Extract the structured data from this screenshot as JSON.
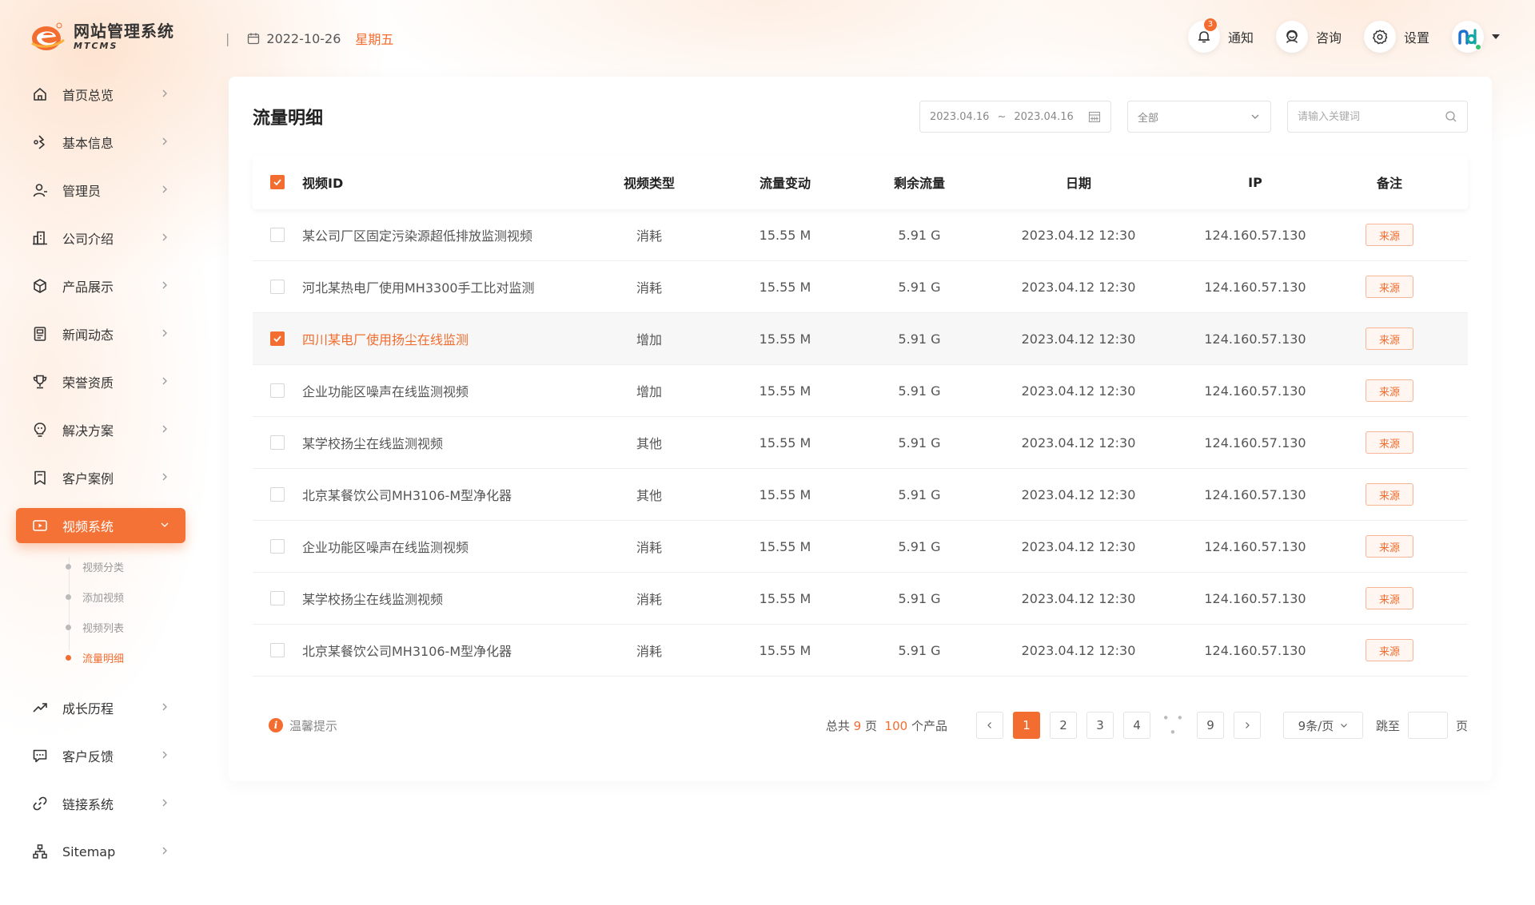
{
  "app": {
    "title": "网站管理系统",
    "subtitle": "MTCMS"
  },
  "header": {
    "date": "2022-10-26",
    "weekday": "星期五",
    "notify": {
      "label": "通知",
      "count": "3"
    },
    "consult": {
      "label": "咨询"
    },
    "settings": {
      "label": "设置"
    }
  },
  "sidebar": {
    "items": [
      {
        "label": "首页总览",
        "icon": "home-icon"
      },
      {
        "label": "基本信息",
        "icon": "info-icon"
      },
      {
        "label": "管理员",
        "icon": "user-icon"
      },
      {
        "label": "公司介绍",
        "icon": "building-icon"
      },
      {
        "label": "产品展示",
        "icon": "cube-icon"
      },
      {
        "label": "新闻动态",
        "icon": "news-icon"
      },
      {
        "label": "荣誉资质",
        "icon": "trophy-icon"
      },
      {
        "label": "解决方案",
        "icon": "bulb-icon"
      },
      {
        "label": "客户案例",
        "icon": "bookmark-icon"
      },
      {
        "label": "视频系统",
        "icon": "video-icon",
        "active": true
      },
      {
        "label": "成长历程",
        "icon": "trend-icon"
      },
      {
        "label": "客户反馈",
        "icon": "chat-icon"
      },
      {
        "label": "链接系统",
        "icon": "link-icon"
      },
      {
        "label": "Sitemap",
        "icon": "sitemap-icon"
      }
    ],
    "video_sub": [
      {
        "label": "视频分类"
      },
      {
        "label": "添加视频"
      },
      {
        "label": "视频列表"
      },
      {
        "label": "流量明细",
        "active": true
      }
    ]
  },
  "main": {
    "title": "流量明细",
    "filters": {
      "date_start": "2023.04.16",
      "date_sep": "~",
      "date_end": "2023.04.16",
      "type_select": "全部",
      "search_placeholder": "请输入关键词"
    },
    "columns": [
      "视频ID",
      "视频类型",
      "流量变动",
      "剩余流量",
      "日期",
      "IP",
      "备注"
    ],
    "rows": [
      {
        "name": "某公司厂区固定污染源超低排放监测视频",
        "type": "消耗",
        "change": "15.55 M",
        "remain": "5.91 G",
        "date": "2023.04.12 12:30",
        "ip": "124.160.57.130",
        "note": "来源",
        "checked": false
      },
      {
        "name": "河北某热电厂使用MH3300手工比对监测",
        "type": "消耗",
        "change": "15.55 M",
        "remain": "5.91 G",
        "date": "2023.04.12 12:30",
        "ip": "124.160.57.130",
        "note": "来源",
        "checked": false
      },
      {
        "name": "四川某电厂使用扬尘在线监测",
        "type": "增加",
        "change": "15.55 M",
        "remain": "5.91 G",
        "date": "2023.04.12 12:30",
        "ip": "124.160.57.130",
        "note": "来源",
        "checked": true
      },
      {
        "name": "企业功能区噪声在线监测视频",
        "type": "增加",
        "change": "15.55 M",
        "remain": "5.91 G",
        "date": "2023.04.12 12:30",
        "ip": "124.160.57.130",
        "note": "来源",
        "checked": false
      },
      {
        "name": "某学校扬尘在线监测视频",
        "type": "其他",
        "change": "15.55 M",
        "remain": "5.91 G",
        "date": "2023.04.12 12:30",
        "ip": "124.160.57.130",
        "note": "来源",
        "checked": false
      },
      {
        "name": "北京某餐饮公司MH3106-M型净化器",
        "type": "其他",
        "change": "15.55 M",
        "remain": "5.91 G",
        "date": "2023.04.12 12:30",
        "ip": "124.160.57.130",
        "note": "来源",
        "checked": false
      },
      {
        "name": "企业功能区噪声在线监测视频",
        "type": "消耗",
        "change": "15.55 M",
        "remain": "5.91 G",
        "date": "2023.04.12 12:30",
        "ip": "124.160.57.130",
        "note": "来源",
        "checked": false
      },
      {
        "name": "某学校扬尘在线监测视频",
        "type": "消耗",
        "change": "15.55 M",
        "remain": "5.91 G",
        "date": "2023.04.12 12:30",
        "ip": "124.160.57.130",
        "note": "来源",
        "checked": false
      },
      {
        "name": "北京某餐饮公司MH3106-M型净化器",
        "type": "消耗",
        "change": "15.55 M",
        "remain": "5.91 G",
        "date": "2023.04.12 12:30",
        "ip": "124.160.57.130",
        "note": "来源",
        "checked": false
      }
    ],
    "footer": {
      "tip": "温馨提示",
      "total_prefix": "总共",
      "total_pages": "9",
      "total_pages_unit": "页",
      "total_items": "100",
      "total_items_unit": "个产品",
      "pages": [
        "1",
        "2",
        "3",
        "4"
      ],
      "ellipsis": "• • •",
      "last_page": "9",
      "current_page": "1",
      "page_size": "9条/页",
      "jump_label": "跳至",
      "jump_unit": "页"
    }
  },
  "colors": {
    "accent": "#f26d2f",
    "tag_bg": "#fff6f1",
    "selected_row": "#f7f7f7"
  }
}
